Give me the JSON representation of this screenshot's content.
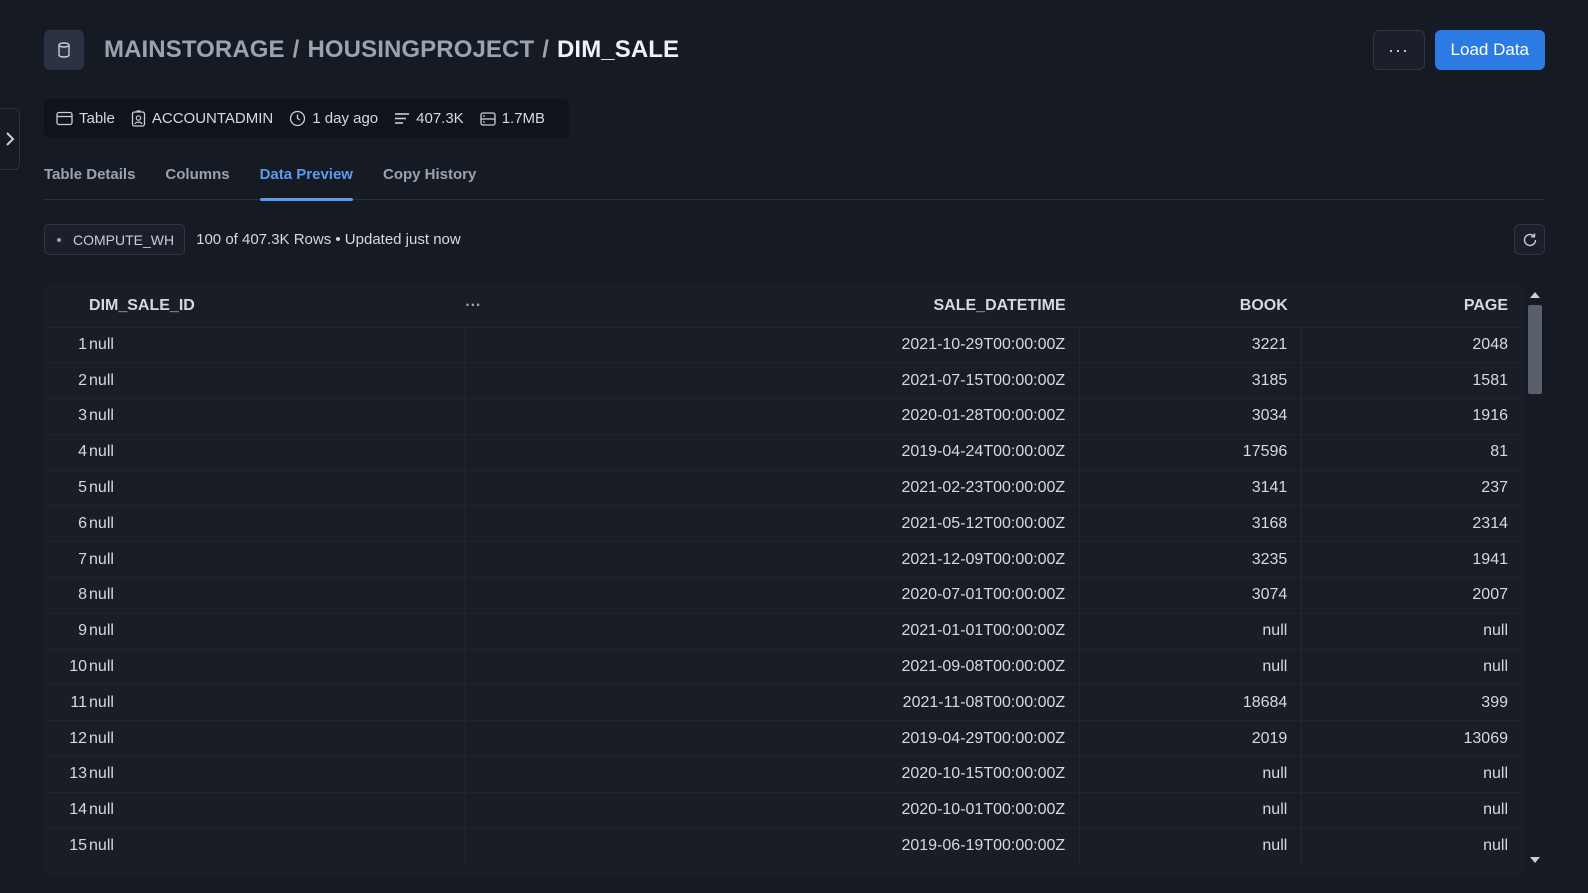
{
  "header": {
    "breadcrumb": [
      "MAINSTORAGE",
      "HOUSINGPROJECT",
      "DIM_SALE"
    ],
    "separator": "/",
    "more_label": "···",
    "load_label": "Load Data"
  },
  "meta": {
    "type": "Table",
    "owner": "ACCOUNTADMIN",
    "updated": "1 day ago",
    "rows": "407.3K",
    "size": "1.7MB"
  },
  "tabs": [
    "Table Details",
    "Columns",
    "Data Preview",
    "Copy History"
  ],
  "active_tab": "Data Preview",
  "toolbar": {
    "warehouse": "COMPUTE_WH",
    "row_status": "100 of 407.3K Rows • Updated just now"
  },
  "table": {
    "columns": [
      "DIM_SALE_ID",
      "SALE_DATETIME",
      "BOOK",
      "PAGE"
    ],
    "column_menu": "···",
    "rows": [
      {
        "n": "1",
        "id": "null",
        "date": "2021-10-29T00:00:00Z",
        "book": "3221",
        "page": "2048"
      },
      {
        "n": "2",
        "id": "null",
        "date": "2021-07-15T00:00:00Z",
        "book": "3185",
        "page": "1581"
      },
      {
        "n": "3",
        "id": "null",
        "date": "2020-01-28T00:00:00Z",
        "book": "3034",
        "page": "1916"
      },
      {
        "n": "4",
        "id": "null",
        "date": "2019-04-24T00:00:00Z",
        "book": "17596",
        "page": "81"
      },
      {
        "n": "5",
        "id": "null",
        "date": "2021-02-23T00:00:00Z",
        "book": "3141",
        "page": "237"
      },
      {
        "n": "6",
        "id": "null",
        "date": "2021-05-12T00:00:00Z",
        "book": "3168",
        "page": "2314"
      },
      {
        "n": "7",
        "id": "null",
        "date": "2021-12-09T00:00:00Z",
        "book": "3235",
        "page": "1941"
      },
      {
        "n": "8",
        "id": "null",
        "date": "2020-07-01T00:00:00Z",
        "book": "3074",
        "page": "2007"
      },
      {
        "n": "9",
        "id": "null",
        "date": "2021-01-01T00:00:00Z",
        "book": "null",
        "page": "null"
      },
      {
        "n": "10",
        "id": "null",
        "date": "2021-09-08T00:00:00Z",
        "book": "null",
        "page": "null"
      },
      {
        "n": "11",
        "id": "null",
        "date": "2021-11-08T00:00:00Z",
        "book": "18684",
        "page": "399"
      },
      {
        "n": "12",
        "id": "null",
        "date": "2019-04-29T00:00:00Z",
        "book": "2019",
        "page": "13069"
      },
      {
        "n": "13",
        "id": "null",
        "date": "2020-10-15T00:00:00Z",
        "book": "null",
        "page": "null"
      },
      {
        "n": "14",
        "id": "null",
        "date": "2020-10-01T00:00:00Z",
        "book": "null",
        "page": "null"
      },
      {
        "n": "15",
        "id": "null",
        "date": "2019-06-19T00:00:00Z",
        "book": "null",
        "page": "null"
      }
    ]
  },
  "colors": {
    "background": "#151a23",
    "accent": "#2c7be5",
    "active_tab": "#5b9cf2"
  }
}
